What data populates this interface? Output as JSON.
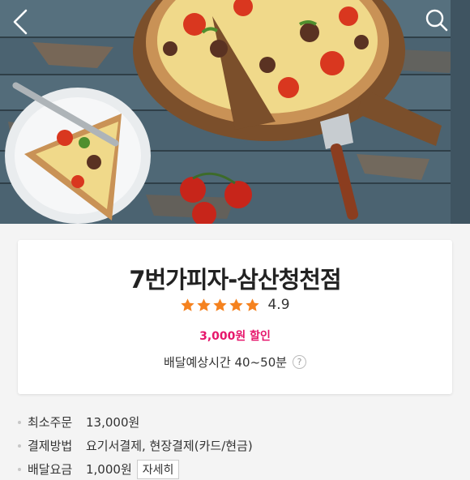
{
  "header": {
    "back_icon": "chevron-left-icon",
    "search_icon": "search-icon",
    "hero_image": "pizza-photo"
  },
  "store": {
    "name": "7번가피자-삼산청천점",
    "rating_value": "4.9",
    "stars": 5,
    "discount": "3,000원 할인",
    "delivery_time": "배달예상시간 40~50분",
    "help_label": "?"
  },
  "info": {
    "rows": [
      {
        "label": "최소주문",
        "value": "13,000원"
      },
      {
        "label": "결제방법",
        "value": "요기서결제, 현장결제(카드/현금)"
      },
      {
        "label": "배달요금",
        "value": "1,000원",
        "button": "자세히"
      }
    ]
  },
  "colors": {
    "accent_pink": "#e6166b",
    "star_orange": "#f5821f",
    "page_background": "#f4f4f4"
  }
}
